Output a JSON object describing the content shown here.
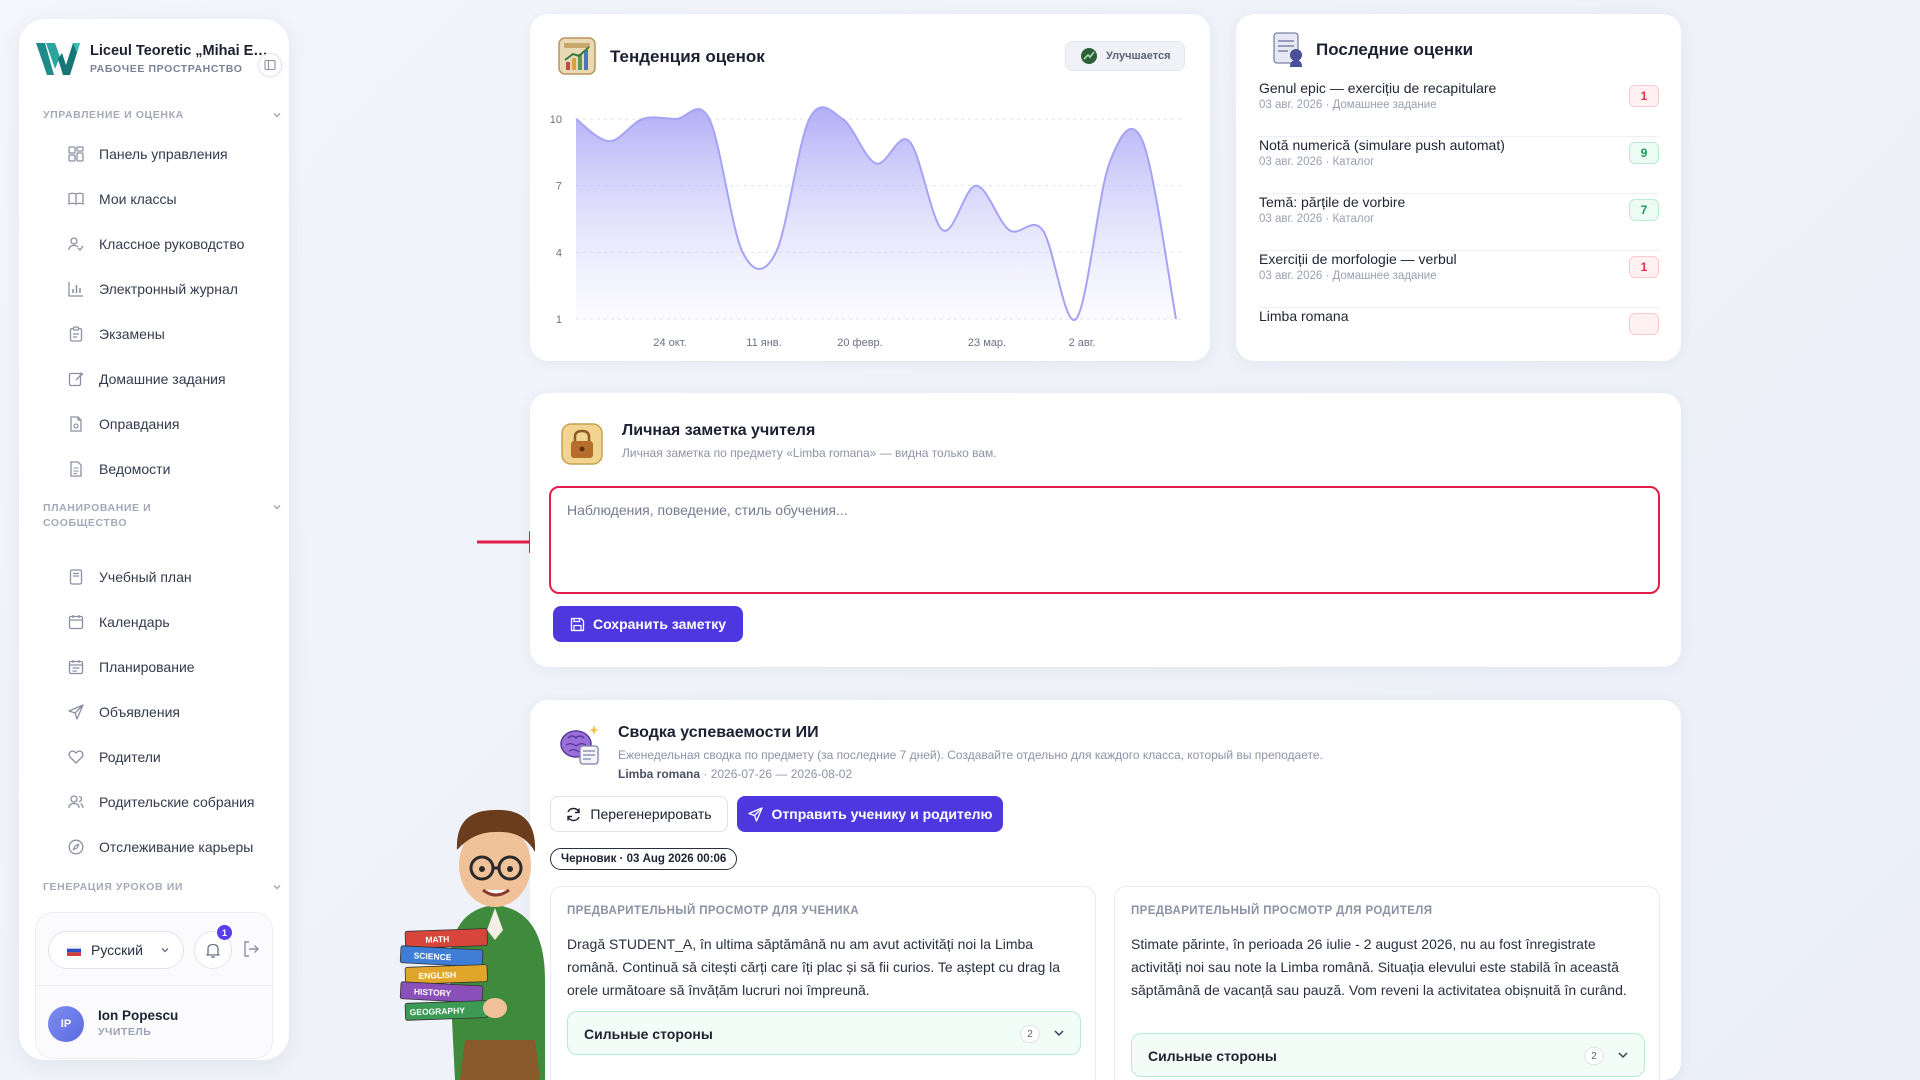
{
  "brand": {
    "title": "Liceul Teoretic „Mihai Eminescu”",
    "subtitle": "РАБОЧЕЕ ПРОСТРАНСТВО"
  },
  "sidebar": {
    "sections": [
      {
        "label": "УПРАВЛЕНИЕ И ОЦЕНКА"
      },
      {
        "label": "ПЛАНИРОВАНИЕ И СООБЩЕСТВО"
      },
      {
        "label": "ГЕНЕРАЦИЯ УРОКОВ ИИ"
      }
    ],
    "items": [
      {
        "label": "Панель управления",
        "icon": "dashboard-icon"
      },
      {
        "label": "Мои классы",
        "icon": "book-icon"
      },
      {
        "label": "Классное руководство",
        "icon": "user-check-icon"
      },
      {
        "label": "Электронный журнал",
        "icon": "bar-chart-icon"
      },
      {
        "label": "Экзамены",
        "icon": "clipboard-icon"
      },
      {
        "label": "Домашние задания",
        "icon": "edit-icon"
      },
      {
        "label": "Оправдания",
        "icon": "file-icon"
      },
      {
        "label": "Ведомости",
        "icon": "document-icon"
      },
      {
        "label": "Учебный план",
        "icon": "book-open-icon"
      },
      {
        "label": "Календарь",
        "icon": "calendar-icon"
      },
      {
        "label": "Планирование",
        "icon": "calendar-check-icon"
      },
      {
        "label": "Объявления",
        "icon": "send-icon"
      },
      {
        "label": "Родители",
        "icon": "heart-icon"
      },
      {
        "label": "Родительские собрания",
        "icon": "users-icon"
      },
      {
        "label": "Отслеживание карьеры",
        "icon": "compass-icon"
      }
    ]
  },
  "user_card": {
    "language": "Русский",
    "notifications": "1",
    "initials": "IP",
    "name": "Ion Popescu",
    "role": "УЧИТЕЛЬ"
  },
  "trend": {
    "title": "Тенденция оценок",
    "badge": "Улучшается"
  },
  "chart_data": {
    "type": "area",
    "title": "Тенденция оценок",
    "ylim": [
      1,
      10
    ],
    "yticks": [
      "10",
      "7",
      "4",
      "1"
    ],
    "xtick_labels": [
      "24 окт.",
      "11 янв.",
      "20 февр.",
      "23 мар.",
      "2 авг."
    ],
    "x": [
      0,
      1,
      2,
      3,
      4,
      5,
      6,
      7,
      8,
      9,
      10,
      11,
      12,
      13,
      14,
      15,
      16,
      17,
      18,
      19,
      20
    ],
    "values": [
      10,
      9,
      10,
      10,
      10,
      4,
      4,
      10,
      10,
      8,
      9,
      5,
      7,
      5,
      5,
      1,
      8,
      9,
      1
    ],
    "colors": {
      "line": "#a6a3f5",
      "fill_top": "#a9a6f6",
      "fill_bottom": "#f1f0fe",
      "grid": "#dfe2ea"
    },
    "grid": true
  },
  "recent_grades": {
    "title": "Последние оценки",
    "items": [
      {
        "name": "Genul epic — exercițiu de recapitulare",
        "meta": "03 авг. 2026 · Домашнее задание",
        "grade": "1",
        "tone": "red"
      },
      {
        "name": "Notă numerică (simulare push automat)",
        "meta": "03 авг. 2026 · Каталог",
        "grade": "9",
        "tone": "green"
      },
      {
        "name": "Temă: părțile de vorbire",
        "meta": "03 авг. 2026 · Каталог",
        "grade": "7",
        "tone": "green"
      },
      {
        "name": "Exerciții de morfologie — verbul",
        "meta": "03 авг. 2026 · Домашнее задание",
        "grade": "1",
        "tone": "red"
      },
      {
        "name": "Limba romana",
        "meta": "",
        "grade": "",
        "tone": "red"
      }
    ]
  },
  "note": {
    "title": "Личная заметка учителя",
    "subtitle": "Личная заметка по предмету «Limba romana» — видна только вам.",
    "placeholder": "Наблюдения, поведение, стиль обучения...",
    "save_label": "Сохранить заметку"
  },
  "ai_summary": {
    "title": "Сводка успеваемости ИИ",
    "subtitle": "Еженедельная сводка по предмету (за последние 7 дней). Создавайте отдельно для каждого класса, который вы преподаете.",
    "subject": "Limba romana",
    "period": " · 2026-07-26 — 2026-08-02",
    "regenerate_label": "Перегенерировать",
    "send_label": "Отправить ученику и родителю",
    "draft_label": "Черновик · 03 Aug 2026 00:06",
    "student_preview": {
      "label": "ПРЕДВАРИТЕЛЬНЫЙ ПРОСМОТР ДЛЯ УЧЕНИКА",
      "text": "Dragă STUDENT_A, în ultima săptămână nu am avut activități noi la Limba română. Continuă să citești cărți care îți plac și să fii curios. Te aștept cu drag la orele următoare să învățăm lucruri noi împreună.",
      "strengths_label": "Сильные стороны",
      "strengths_count": "2"
    },
    "parent_preview": {
      "label": "ПРЕДВАРИТЕЛЬНЫЙ ПРОСМОТР ДЛЯ РОДИТЕЛЯ",
      "text": "Stimate părinte, în perioada 26 iulie - 2 august 2026, nu au fost înregistrate activități noi sau note la Limba română. Situația elevului este stabilă în această săptămână de vacanță sau pauză. Vom reveni la activitatea obișnuită în curând.",
      "strengths_label": "Сильные стороны",
      "strengths_count": "2"
    }
  },
  "mascot_books": [
    "MATH",
    "SCIENCE",
    "ENGLISH",
    "HISTORY",
    "GEOGRAPHY"
  ]
}
